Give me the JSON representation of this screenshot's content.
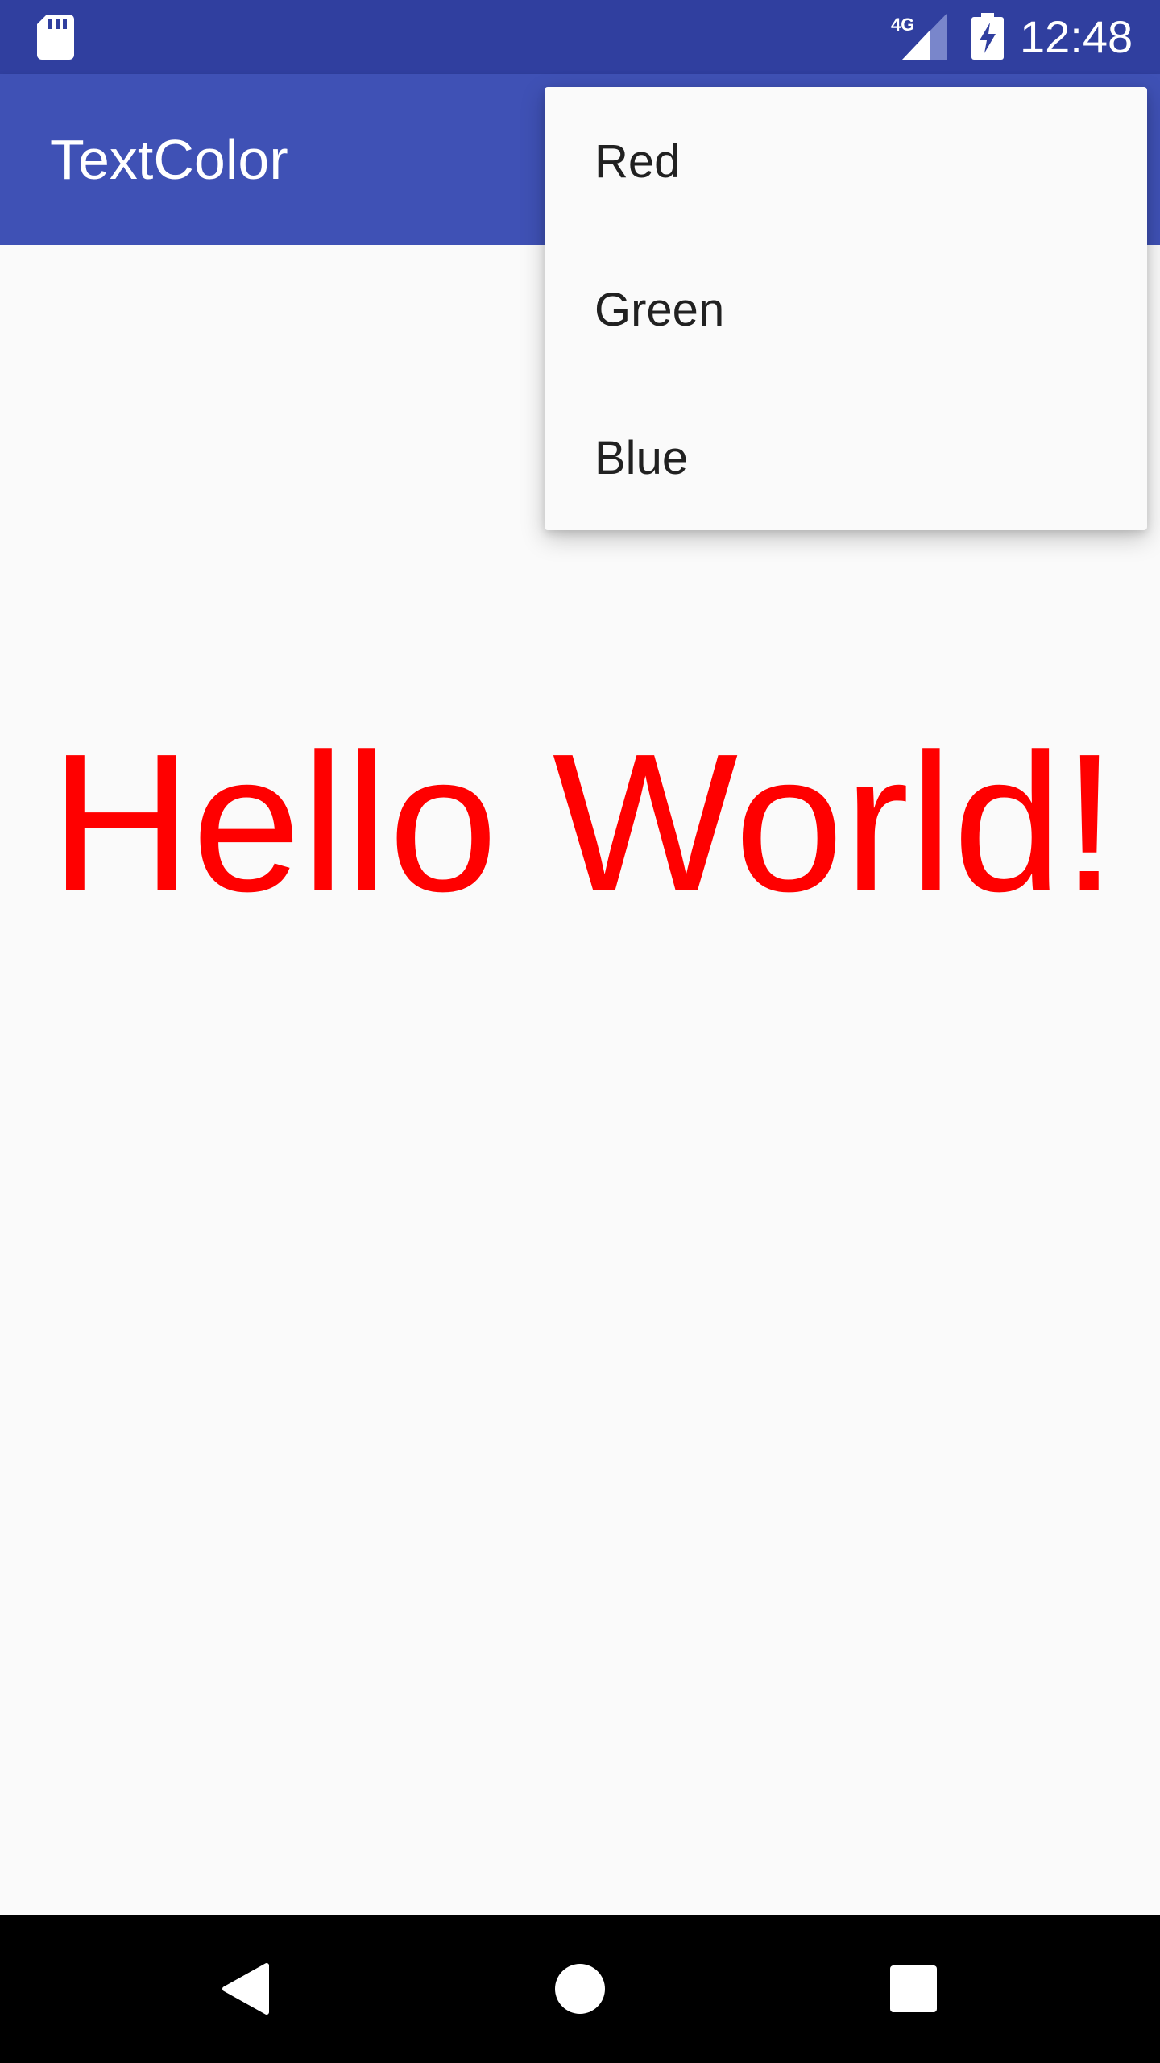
{
  "status_bar": {
    "time": "12:48",
    "network_label": "4G",
    "icons": [
      "sd-card-icon",
      "signal-icon",
      "battery-charging-icon"
    ]
  },
  "app_bar": {
    "title": "TextColor"
  },
  "content": {
    "hello_text": "Hello World!",
    "text_color": "#ff0000"
  },
  "menu": {
    "items": [
      {
        "label": "Red"
      },
      {
        "label": "Green"
      },
      {
        "label": "Blue"
      }
    ]
  },
  "navigation": {
    "icons": [
      "back-icon",
      "home-icon",
      "recents-icon"
    ]
  },
  "colors": {
    "status_bar": "#303f9f",
    "app_bar": "#3f51b5",
    "background": "#fafafa",
    "nav_bar": "#000000"
  }
}
